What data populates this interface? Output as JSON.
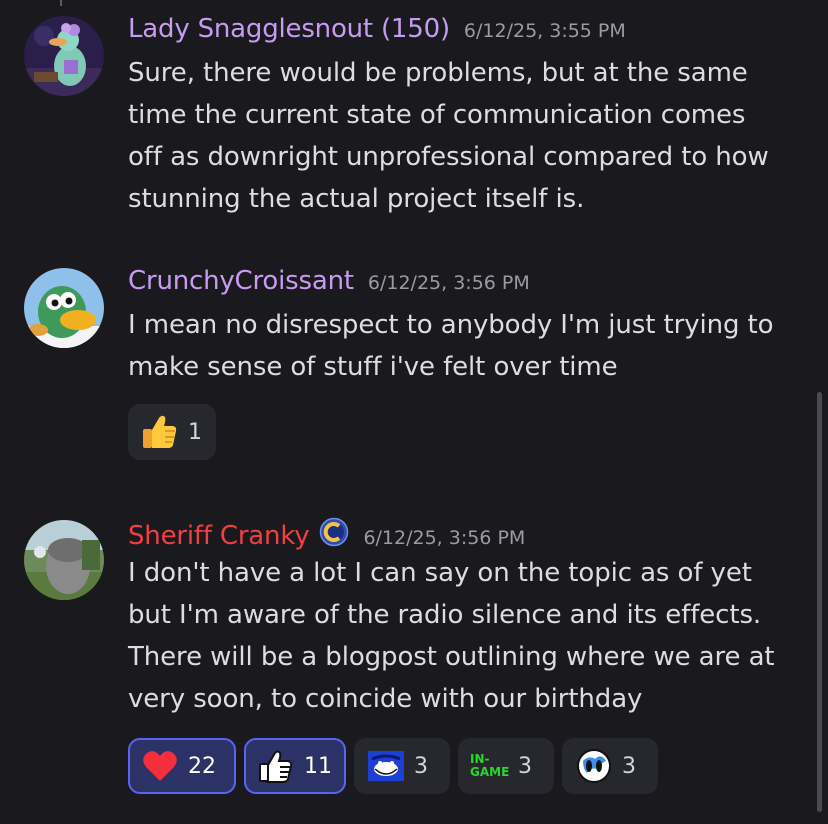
{
  "messages": [
    {
      "author": "Lady Snagglesnout (150)",
      "author_color": "#c79bf2",
      "timestamp": "6/12/25, 3:55 PM",
      "lines": [
        "Sure, there would be problems, but at the same",
        "time the current state of communication comes",
        "off as downright unprofessional compared to how",
        "stunning the actual project itself is."
      ]
    },
    {
      "author": "CrunchyCroissant",
      "author_color": "#c79bf2",
      "timestamp": "6/12/25, 3:56 PM",
      "lines": [
        "I mean no disrespect to anybody I'm just trying to",
        "make sense of stuff i've felt over time"
      ],
      "reactions": [
        {
          "emoji": "thumbs-up",
          "count": "1"
        }
      ]
    },
    {
      "author": "Sheriff Cranky",
      "author_color": "#f23f42",
      "timestamp": "6/12/25, 3:56 PM",
      "lines": [
        "I don't have a lot I can say on the topic as of yet",
        "but I'm aware of the radio silence and its effects.",
        "There will be a blogpost outlining where we are at",
        "very soon, to coincide with our birthday"
      ],
      "reactions": [
        {
          "emoji": "red-heart",
          "count": "22"
        },
        {
          "emoji": "thumbs-up-outline",
          "count": "11"
        },
        {
          "emoji": "troll-face-blue",
          "count": "3"
        },
        {
          "emoji": "in-game",
          "count": "3",
          "label": "IN- GAME"
        },
        {
          "emoji": "globe-face",
          "count": "3"
        }
      ]
    }
  ]
}
